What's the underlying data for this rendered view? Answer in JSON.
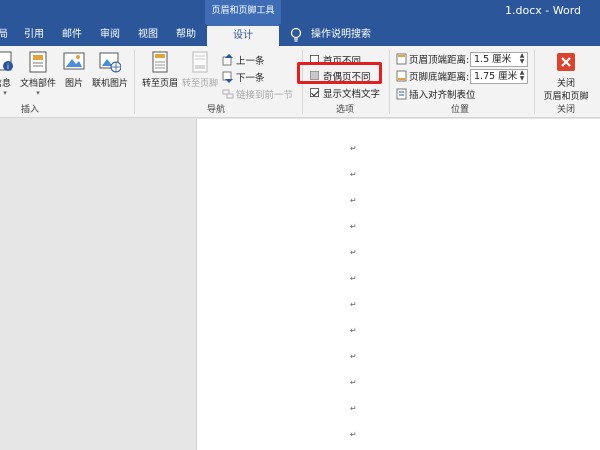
{
  "window": {
    "context_group": "页眉和页脚工具",
    "doc_title": "1.docx  -  Word"
  },
  "tabs": {
    "items": [
      {
        "label": "局"
      },
      {
        "label": "引用"
      },
      {
        "label": "邮件"
      },
      {
        "label": "审阅"
      },
      {
        "label": "视图"
      },
      {
        "label": "帮助"
      },
      {
        "label": "设计",
        "active": true
      }
    ],
    "tell_me": "操作说明搜索"
  },
  "ribbon": {
    "insert": {
      "label": "插入",
      "doc_info": "信息",
      "quick_parts": "文档部件",
      "pictures": "图片",
      "online_pictures": "联机图片"
    },
    "navigation": {
      "label": "导航",
      "goto_header": "转至页眉",
      "goto_footer": "转至页脚",
      "previous": "上一条",
      "next": "下一条",
      "link_previous": "链接到前一节"
    },
    "options": {
      "label": "选项",
      "different_first": "首页不同",
      "different_odd_even": "奇偶页不同",
      "show_doc_text": "显示文档文字",
      "different_first_checked": false,
      "different_odd_even_checked": false,
      "show_doc_text_checked": true
    },
    "position": {
      "label": "位置",
      "header_from_top_label": "页眉顶端距离:",
      "header_from_top_value": "1.5 厘米",
      "footer_from_bottom_label": "页脚底端距离:",
      "footer_from_bottom_value": "1.75 厘米",
      "insert_align_tab": "插入对齐制表位"
    },
    "close": {
      "label": "关闭",
      "button_line1": "关闭",
      "button_line2": "页眉和页脚"
    }
  },
  "document": {
    "paragraph_mark": "↵"
  },
  "colors": {
    "brand": "#2b579a",
    "ribbon_bg": "#f3f3f3",
    "highlight": "#e02020",
    "close_button": "#d9432f"
  }
}
